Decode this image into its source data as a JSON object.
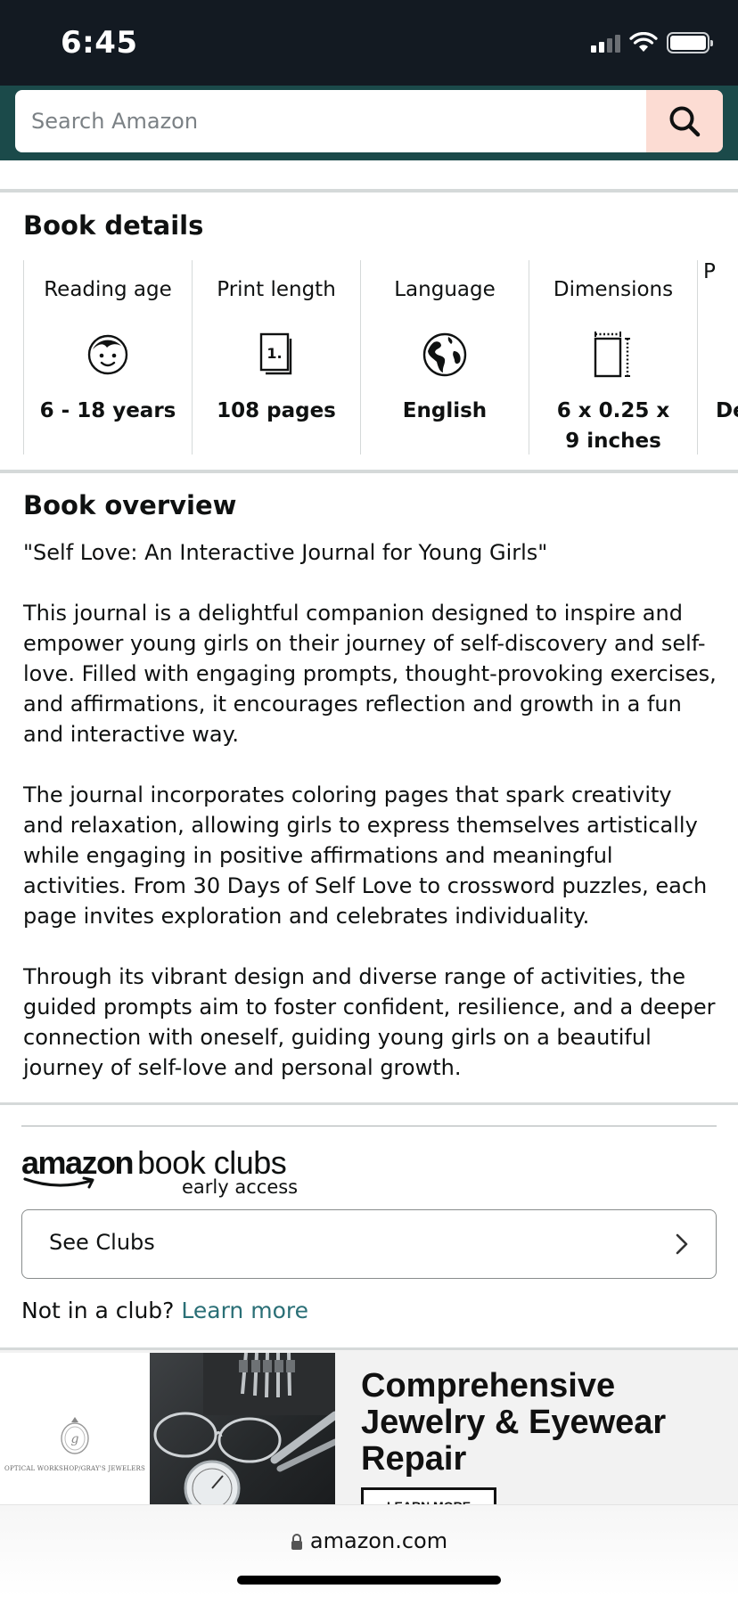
{
  "status_bar": {
    "time": "6:45"
  },
  "search": {
    "placeholder": "Search Amazon"
  },
  "book_details": {
    "title": "Book details",
    "items": [
      {
        "label": "Reading age",
        "icon": "child-face-icon",
        "value": "6 - 18 years"
      },
      {
        "label": "Print length",
        "icon": "page-count-icon",
        "value": "108 pages"
      },
      {
        "label": "Language",
        "icon": "globe-icon",
        "value": "English"
      },
      {
        "label": "Dimensions",
        "icon": "dimensions-icon",
        "value": "6 x 0.25 x 9 inches"
      },
      {
        "label": "P",
        "icon": "",
        "value": "De"
      }
    ]
  },
  "book_overview": {
    "title": "Book overview",
    "paragraphs": [
      "\"Self Love: An Interactive Journal for Young Girls\"",
      "This journal is a delightful companion designed to inspire and empower young girls on their journey of self-discovery and self-love. Filled with engaging prompts, thought-provoking exercises, and affirmations, it encourages reflection and growth in a fun and interactive way.",
      "The journal incorporates coloring pages that spark creativity and relaxation, allowing girls to express themselves artistically while engaging in positive affirmations and meaningful activities. From 30 Days of Self Love to crossword puzzles, each page invites exploration and celebrates individuality.",
      "Through its vibrant design and diverse range of activities, the guided prompts aim to foster confident, resilience, and a deeper connection with oneself, guiding young girls on a beautiful journey of self-love and personal growth."
    ]
  },
  "book_clubs": {
    "logo_amazon": "amazon",
    "logo_clubs": "book clubs",
    "logo_sub": "early access",
    "see_clubs_label": "See Clubs",
    "not_in_club_text": "Not in a club?",
    "learn_more_link": "Learn more"
  },
  "ad": {
    "logo_text": "OPTICAL WORKSHOP/GRAY'S JEWELERS",
    "headline": "Comprehensive Jewelry & Eyewear Repair",
    "cta": "LEARN MORE"
  },
  "browser": {
    "url": "amazon.com"
  },
  "colors": {
    "status_bar_bg": "#131a22",
    "header_bg": "#1b4a4a",
    "search_button_bg": "#fcdcd3",
    "link": "#2a6f76"
  }
}
